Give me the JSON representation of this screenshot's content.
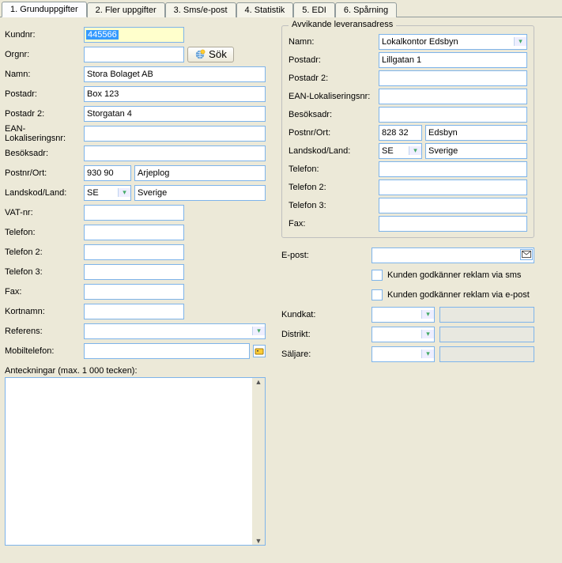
{
  "tabs": [
    "1. Grunduppgifter",
    "2. Fler uppgifter",
    "3. Sms/e-post",
    "4. Statistik",
    "5. EDI",
    "6. Spårning"
  ],
  "left": {
    "kundnr_label": "Kundnr:",
    "kundnr": "445566",
    "orgnr_label": "Orgnr:",
    "orgnr": "",
    "sok": "Sök",
    "namn_label": "Namn:",
    "namn": "Stora Bolaget AB",
    "postadr_label": "Postadr:",
    "postadr": "Box 123",
    "postadr2_label": "Postadr 2:",
    "postadr2": "Storgatan 4",
    "ean_label": "EAN-Lokaliseringsnr:",
    "ean": "",
    "besok_label": "Besöksadr:",
    "besok": "",
    "postnrort_label": "Postnr/Ort:",
    "postnr": "930 90",
    "ort": "Arjeplog",
    "landskod_label": "Landskod/Land:",
    "landskod": "SE",
    "land": "Sverige",
    "vat_label": "VAT-nr:",
    "tel_label": "Telefon:",
    "tel2_label": "Telefon 2:",
    "tel3_label": "Telefon 3:",
    "fax_label": "Fax:",
    "kortnamn_label": "Kortnamn:",
    "referens_label": "Referens:",
    "mobil_label": "Mobiltelefon:",
    "anteck_label": "Anteckningar (max. 1 000 tecken):"
  },
  "right": {
    "group_title": "Avvikande leveransadress",
    "namn_label": "Namn:",
    "namn": "Lokalkontor Edsbyn",
    "postadr_label": "Postadr:",
    "postadr": "Lillgatan 1",
    "postadr2_label": "Postadr 2:",
    "ean_label": "EAN-Lokaliseringsnr:",
    "besok_label": "Besöksadr:",
    "postnrort_label": "Postnr/Ort:",
    "postnr": "828 32",
    "ort": "Edsbyn",
    "landskod_label": "Landskod/Land:",
    "landskod": "SE",
    "land": "Sverige",
    "tel_label": "Telefon:",
    "tel2_label": "Telefon 2:",
    "tel3_label": "Telefon 3:",
    "fax_label": "Fax:",
    "epost_label": "E-post:",
    "chk_sms": "Kunden godkänner reklam via sms",
    "chk_email": "Kunden godkänner reklam via e-post",
    "kundkat_label": "Kundkat:",
    "distrikt_label": "Distrikt:",
    "saljare_label": "Säljare:"
  }
}
